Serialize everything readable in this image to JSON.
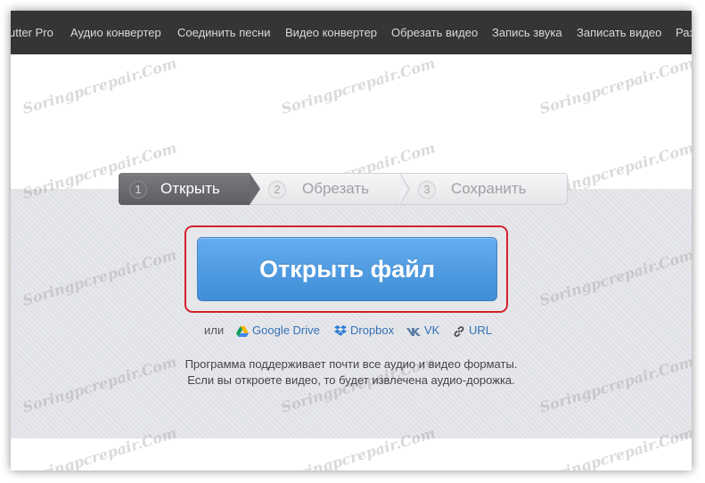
{
  "nav": {
    "items": [
      "utter Pro",
      "Аудио конвертер",
      "Соединить песни",
      "Видео конвертер",
      "Обрезать видео",
      "Запись звука",
      "Записать видео",
      "Раз"
    ]
  },
  "steps": [
    {
      "num": "1",
      "label": "Открыть",
      "active": true
    },
    {
      "num": "2",
      "label": "Обрезать",
      "active": false
    },
    {
      "num": "3",
      "label": "Сохранить",
      "active": false
    }
  ],
  "open_button": {
    "label": "Открыть файл"
  },
  "sources": {
    "or_label": "или",
    "items": [
      {
        "label": "Google Drive",
        "icon": "google-drive-icon"
      },
      {
        "label": "Dropbox",
        "icon": "dropbox-icon"
      },
      {
        "label": "VK",
        "icon": "vk-icon"
      },
      {
        "label": "URL",
        "icon": "link-icon"
      }
    ]
  },
  "description": {
    "line1": "Программа поддерживает почти все аудио и видео форматы.",
    "line2": "Если вы откроете видео, то будет извлечена  аудио-дорожка."
  },
  "watermark": "Soringpcrepair.Com",
  "colors": {
    "nav_bg": "#353535",
    "accent_blue": "#4a98e0",
    "highlight_red": "#d4222a",
    "link_blue": "#3471b7"
  }
}
